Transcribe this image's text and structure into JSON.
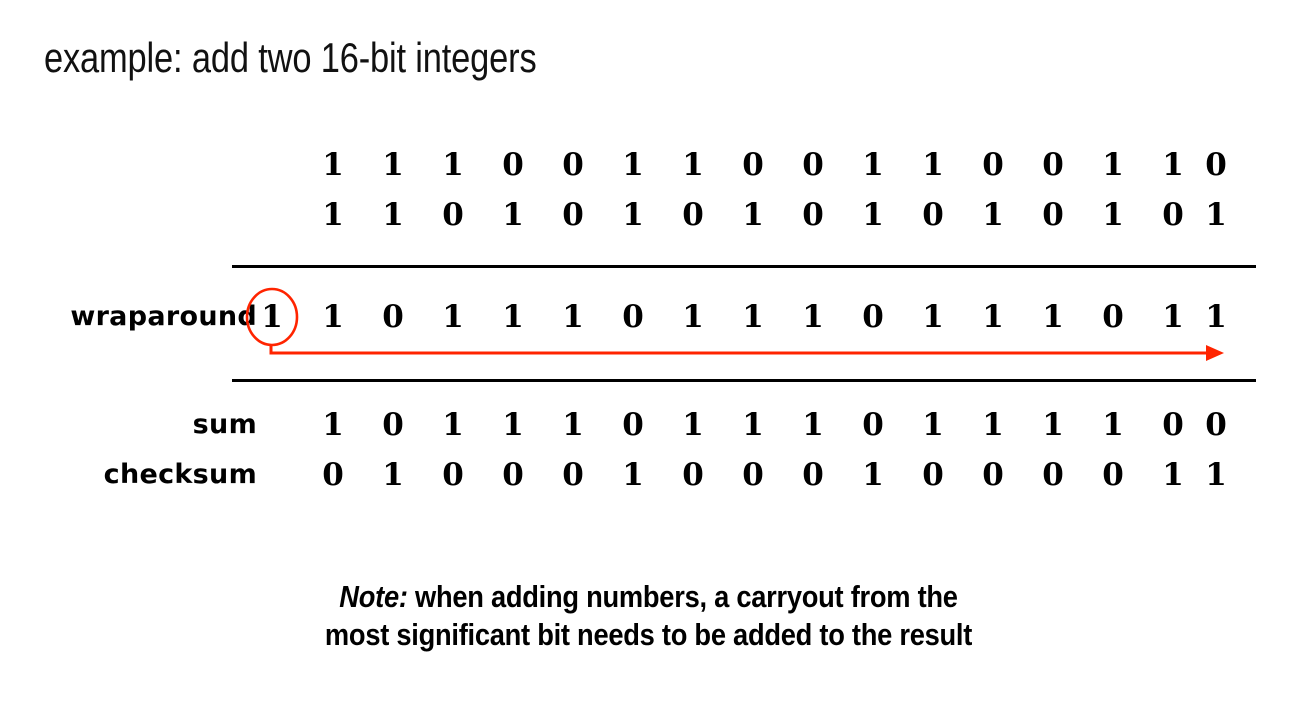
{
  "slide": {
    "title": "example: add two 16-bit integers",
    "background_color": "#ffffff",
    "text_color": "#000000",
    "accent_color": "#ff2400"
  },
  "addition": {
    "bit_width": 16,
    "operands": [
      {
        "label": "",
        "bits": [
          "1",
          "1",
          "1",
          "0",
          "0",
          "1",
          "1",
          "0",
          "0",
          "1",
          "1",
          "0",
          "0",
          "1",
          "1",
          "0"
        ]
      },
      {
        "label": "",
        "bits": [
          "1",
          "1",
          "0",
          "1",
          "0",
          "1",
          "0",
          "1",
          "0",
          "1",
          "0",
          "1",
          "0",
          "1",
          "0",
          "1"
        ]
      }
    ],
    "wraparound": {
      "label": "wraparound",
      "carry_bit": "1",
      "bits": [
        "1",
        "0",
        "1",
        "1",
        "1",
        "0",
        "1",
        "1",
        "1",
        "0",
        "1",
        "1",
        "1",
        "0",
        "1",
        "1"
      ]
    },
    "sum": {
      "label": "sum",
      "bits": [
        "1",
        "0",
        "1",
        "1",
        "1",
        "0",
        "1",
        "1",
        "1",
        "0",
        "1",
        "1",
        "1",
        "1",
        "0",
        "0"
      ]
    },
    "checksum": {
      "label": "checksum",
      "bits": [
        "0",
        "1",
        "0",
        "0",
        "0",
        "1",
        "0",
        "0",
        "0",
        "1",
        "0",
        "0",
        "0",
        "0",
        "1",
        "1"
      ]
    }
  },
  "note": {
    "lead": "Note:",
    "line1_rest": " when adding numbers, a carryout from the",
    "line2": "most significant bit needs to be added to the result"
  }
}
